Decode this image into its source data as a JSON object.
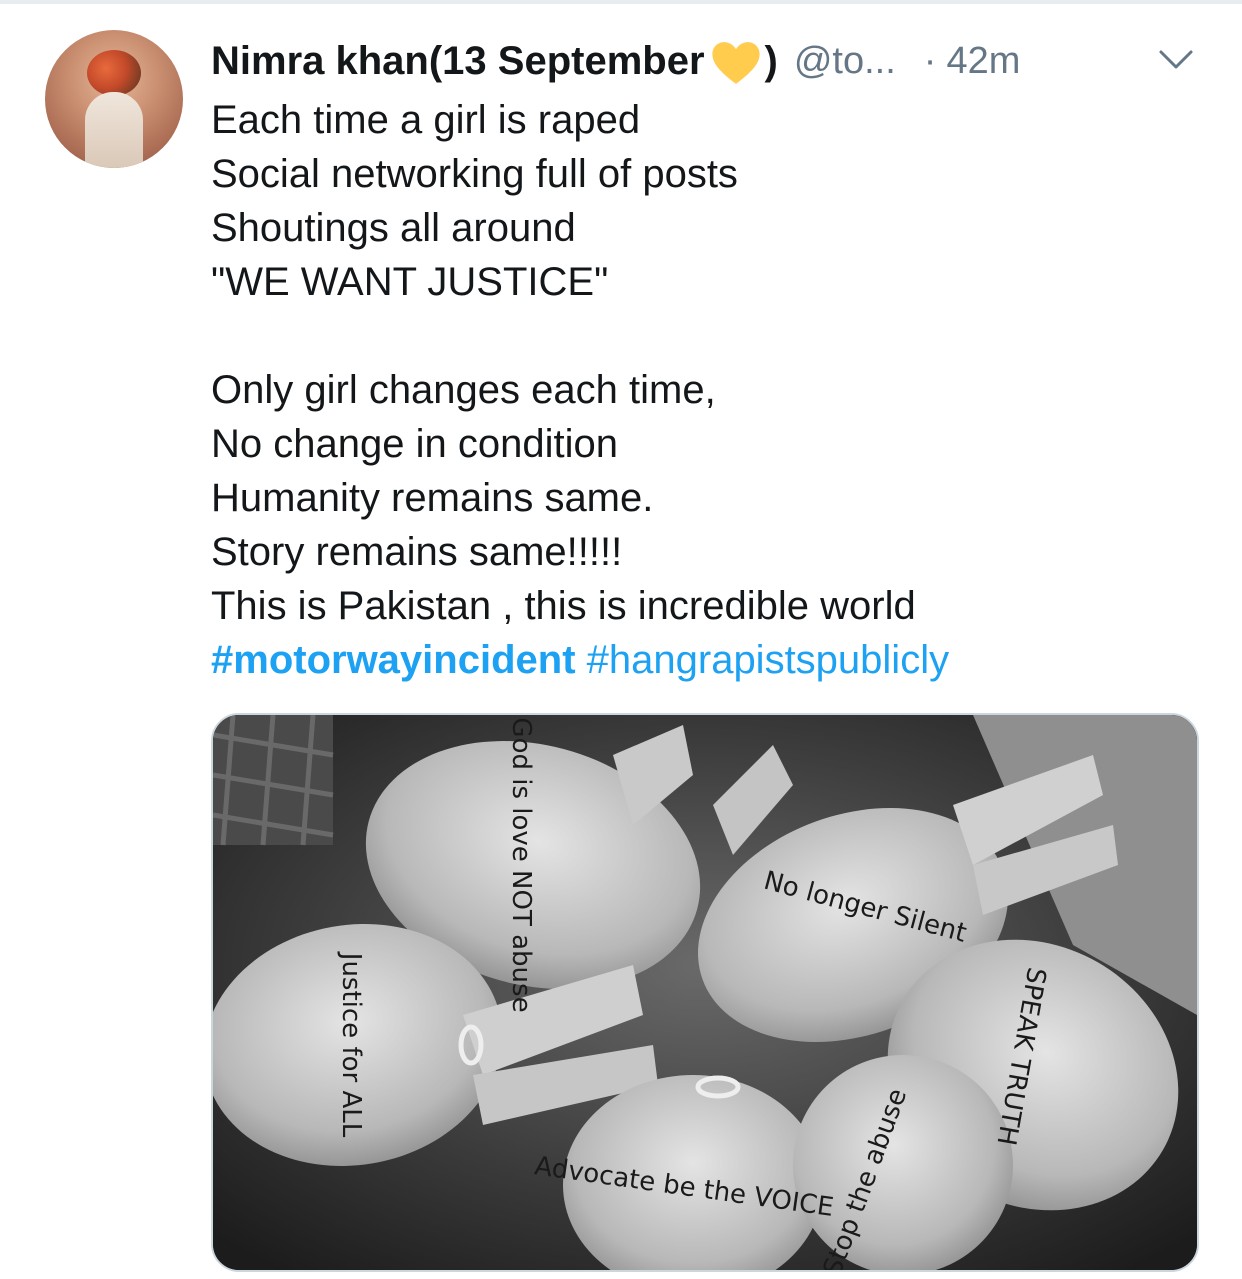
{
  "tweet": {
    "display_name": "Nimra khan(13 September",
    "display_name_close": ")",
    "emoji_name": "yellow-heart",
    "handle": "@to...",
    "separator": "·",
    "time": "42m",
    "lines": [
      "Each time a girl is raped",
      "Social networking full of posts",
      "Shoutings all around",
      "\"WE WANT JUSTICE\"",
      "",
      "Only girl changes each time,",
      "No change in condition",
      "Humanity remains same.",
      "Story remains same!!!!!",
      "This is Pakistan , this is incredible world"
    ],
    "hashtags": [
      "#motorwayincident",
      "#hangrapistspublicly"
    ],
    "media": {
      "type": "photo",
      "palm_texts": [
        "God is love NOT abuse",
        "No longer Silent",
        "Justice for ALL",
        "SPEAK TRUTH",
        "Stop the abuse",
        "Advocate be the VOICE"
      ]
    }
  },
  "colors": {
    "text": "#14171a",
    "secondary": "#657786",
    "link": "#1da1f2",
    "heart": "#ffcc4d",
    "border": "#ccd6dd"
  }
}
